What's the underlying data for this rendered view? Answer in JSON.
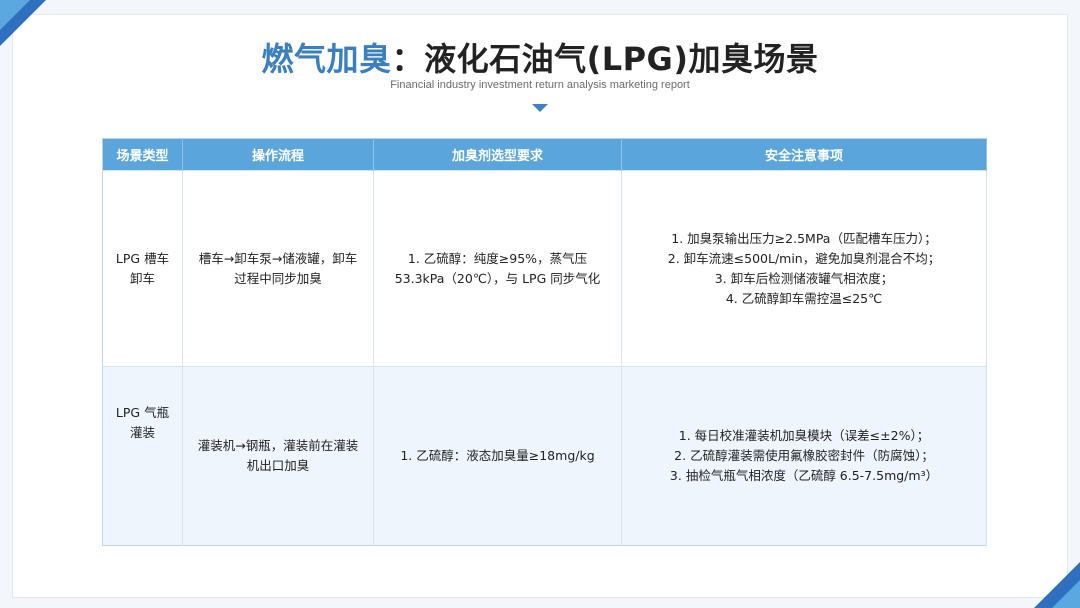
{
  "header": {
    "title_highlight": "燃气加臭",
    "title_separator": "：",
    "title_main": "液化石油气(LPG)加臭场景",
    "subtitle": "Financial industry investment return analysis marketing report"
  },
  "table": {
    "columns": [
      "场景类型",
      "操作流程",
      "加臭剂选型要求",
      "安全注意事项"
    ],
    "rows": [
      {
        "scene": [
          "LPG 槽车",
          "卸车"
        ],
        "process": [
          "槽车→卸车泵→储液罐，卸车",
          "过程中同步加臭"
        ],
        "requirement": [
          "1. 乙硫醇：纯度≥95%，蒸气压",
          "53.3kPa（20℃），与 LPG 同步气化"
        ],
        "safety": [
          "1. 加臭泵输出压力≥2.5MPa（匹配槽车压力）；",
          "2. 卸车流速≤500L/min，避免加臭剂混合不均；",
          "3. 卸车后检测储液罐气相浓度；",
          "4. 乙硫醇卸车需控温≤25℃"
        ]
      },
      {
        "scene": [
          "LPG 气瓶",
          "灌装"
        ],
        "process": [
          "灌装机→钢瓶，灌装前在灌装",
          "机出口加臭"
        ],
        "requirement": [
          "1. 乙硫醇：液态加臭量≥18mg/kg"
        ],
        "safety": [
          "1. 每日校准灌装机加臭模块（误差≤±2%）；",
          "2. 乙硫醇灌装需使用氟橡胶密封件（防腐蚀）；",
          "3. 抽检气瓶气相浓度（乙硫醇 6.5-7.5mg/m³）"
        ]
      }
    ]
  },
  "colors": {
    "accent": "#3a7fc1",
    "header_bg": "#5aa6dc",
    "row_alt_bg": "#eef5fc"
  }
}
